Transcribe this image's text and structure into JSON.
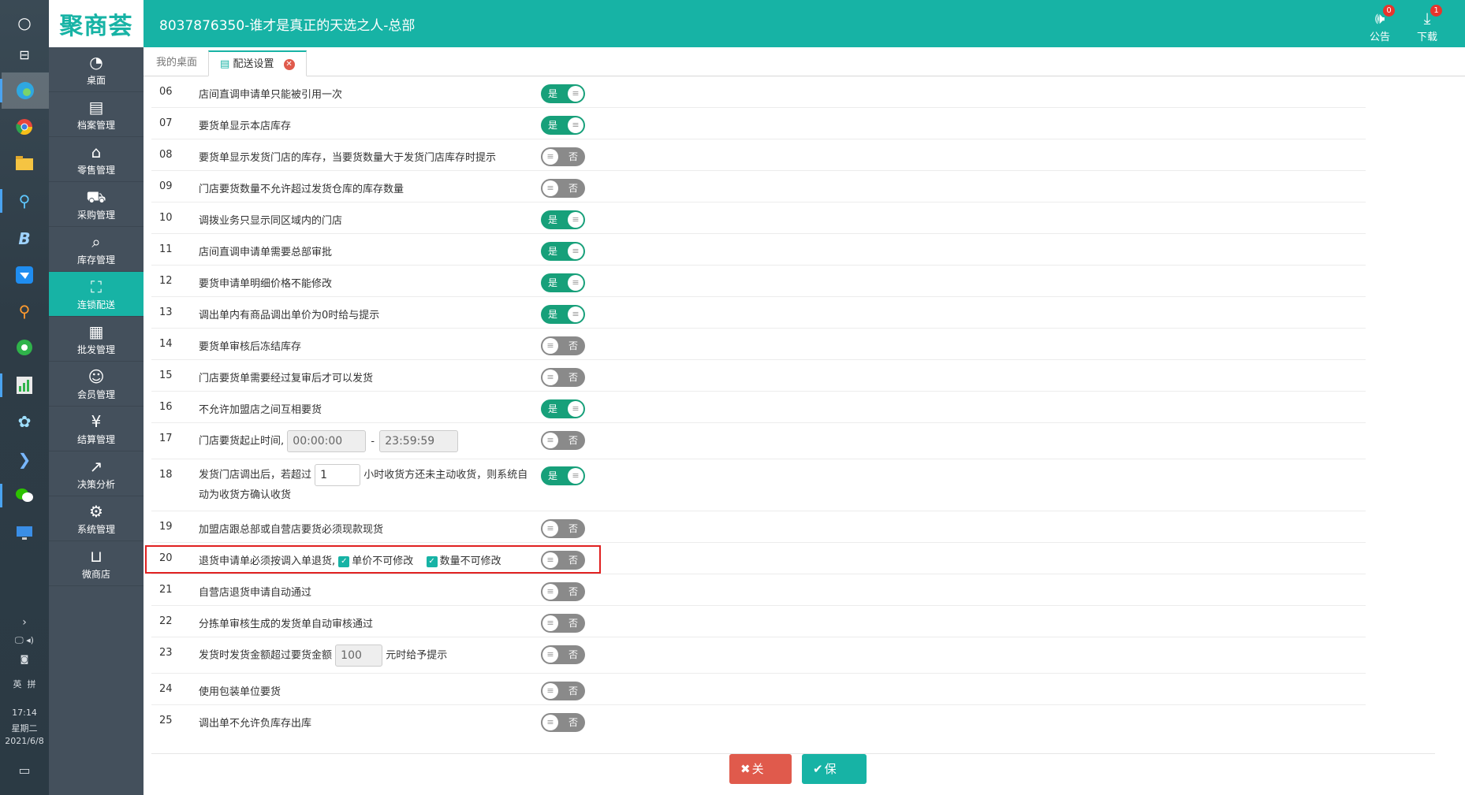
{
  "header": {
    "logo": "聚商荟",
    "title": "8037876350-谁才是真正的天选之人-总部",
    "notice_label": "公告",
    "notice_badge": "0",
    "download_label": "下载",
    "download_badge": "1"
  },
  "taskbar": {
    "ime_label": "英",
    "ime_mode": "拼",
    "time": "17:14",
    "weekday": "星期二",
    "date": "2021/6/8"
  },
  "sidenav": [
    {
      "label": "桌面",
      "icon": "dashboard-icon"
    },
    {
      "label": "档案管理",
      "icon": "archive-icon"
    },
    {
      "label": "零售管理",
      "icon": "store-icon"
    },
    {
      "label": "采购管理",
      "icon": "cart-icon"
    },
    {
      "label": "库存管理",
      "icon": "inventory-icon"
    },
    {
      "label": "连锁配送",
      "icon": "delivery-icon"
    },
    {
      "label": "批发管理",
      "icon": "wholesale-icon"
    },
    {
      "label": "会员管理",
      "icon": "member-icon"
    },
    {
      "label": "结算管理",
      "icon": "settlement-icon"
    },
    {
      "label": "决策分析",
      "icon": "chart-icon"
    },
    {
      "label": "系统管理",
      "icon": "gear-icon"
    },
    {
      "label": "微商店",
      "icon": "bag-icon"
    }
  ],
  "tabs": [
    {
      "label": "我的桌面"
    },
    {
      "label": "配送设置"
    }
  ],
  "settings": [
    {
      "num": "06",
      "label": "店间直调申请单只能被引用一次",
      "on": true
    },
    {
      "num": "07",
      "label": "要货单显示本店库存",
      "on": true
    },
    {
      "num": "08",
      "label": "要货单显示发货门店的库存，当要货数量大于发货门店库存时提示",
      "on": false
    },
    {
      "num": "09",
      "label": "门店要货数量不允许超过发货仓库的库存数量",
      "on": false
    },
    {
      "num": "10",
      "label": "调拨业务只显示同区域内的门店",
      "on": true
    },
    {
      "num": "11",
      "label": "店间直调申请单需要总部审批",
      "on": true
    },
    {
      "num": "12",
      "label": "要货申请单明细价格不能修改",
      "on": true
    },
    {
      "num": "13",
      "label": "调出单内有商品调出单价为0时给与提示",
      "on": true
    },
    {
      "num": "14",
      "label": "要货单审核后冻结库存",
      "on": false
    },
    {
      "num": "15",
      "label": "门店要货单需要经过复审后才可以发货",
      "on": false
    },
    {
      "num": "16",
      "label": "不允许加盟店之间互相要货",
      "on": true
    },
    {
      "num": "17",
      "label": "门店要货起止时间",
      "on": false,
      "start": "00:00:00",
      "sep": "-",
      "end": "23:59:59"
    },
    {
      "num": "18",
      "label_a": "发货门店调出后，若超过",
      "hours": "1",
      "label_b": "小时收货方还未主动收货，则系统自动为收货方确认收货",
      "on": true
    },
    {
      "num": "19",
      "label": "加盟店跟总部或自营店要货必须现款现货",
      "on": false
    },
    {
      "num": "20",
      "label": "退货申请单必须按调入单退货,",
      "check1": "单价不可修改",
      "check2": "数量不可修改",
      "on": false
    },
    {
      "num": "21",
      "label": "自营店退货申请自动通过",
      "on": false
    },
    {
      "num": "22",
      "label": "分拣单审核生成的发货单自动审核通过",
      "on": false
    },
    {
      "num": "23",
      "label_a": "发货时发货金额超过要货金额",
      "amount": "100",
      "label_b": "元时给予提示",
      "on": false
    },
    {
      "num": "24",
      "label": "使用包装单位要货",
      "on": false
    },
    {
      "num": "25",
      "label": "调出单不允许负库存出库",
      "on": false
    }
  ],
  "switch_text": {
    "on": "是",
    "off": "否"
  },
  "buttons": {
    "close": "关 闭",
    "save": "保 存"
  },
  "colors": {
    "brand": "#17b3a5",
    "switch_on": "#17a07a",
    "switch_off": "#8a8a8a",
    "danger": "#e05a4c"
  }
}
